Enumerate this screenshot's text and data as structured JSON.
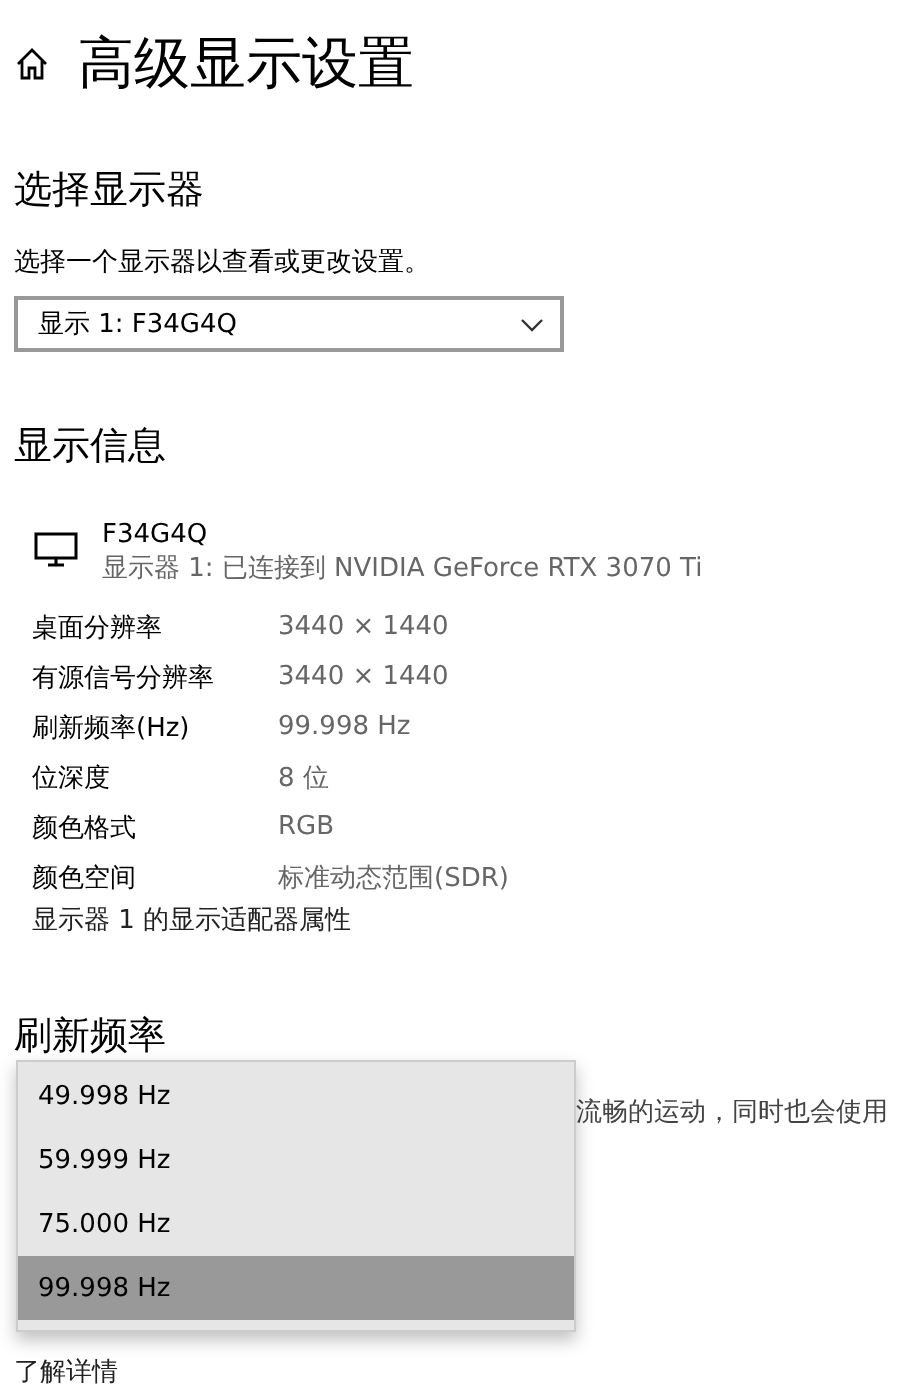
{
  "page": {
    "title": "高级显示设置"
  },
  "select_display": {
    "heading": "选择显示器",
    "hint": "选择一个显示器以查看或更改设置。",
    "dropdown_value": "显示 1: F34G4Q"
  },
  "display_info": {
    "heading": "显示信息",
    "monitor_name": "F34G4Q",
    "monitor_subtitle": "显示器 1: 已连接到 NVIDIA GeForce RTX 3070 Ti",
    "rows": [
      {
        "label": "桌面分辨率",
        "value": "3440 × 1440"
      },
      {
        "label": "有源信号分辨率",
        "value": "3440 × 1440"
      },
      {
        "label": "刷新频率(Hz)",
        "value": "99.998 Hz"
      },
      {
        "label": "位深度",
        "value": "8 位"
      },
      {
        "label": "颜色格式",
        "value": "RGB"
      },
      {
        "label": "颜色空间",
        "value": "标准动态范围(SDR)"
      }
    ],
    "adapter_link": "显示器 1 的显示适配器属性"
  },
  "refresh_rate": {
    "heading": "刷新频率",
    "description": "流畅的运动，同时也会使用",
    "learn_more": "了解详情",
    "options": [
      {
        "label": "49.998 Hz",
        "selected": false
      },
      {
        "label": "59.999 Hz",
        "selected": false
      },
      {
        "label": "75.000 Hz",
        "selected": false
      },
      {
        "label": "99.998 Hz",
        "selected": true
      }
    ]
  }
}
